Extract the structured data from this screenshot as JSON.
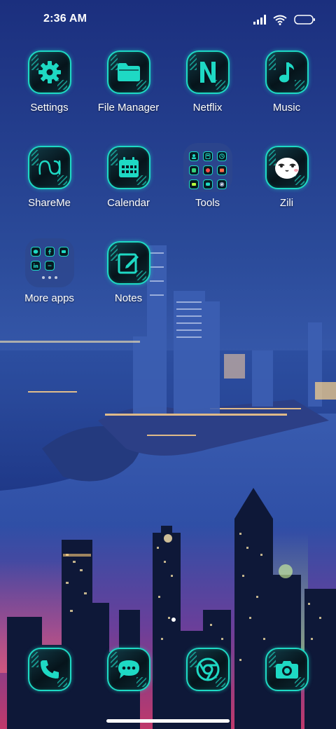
{
  "status_bar": {
    "time": "2:36 AM"
  },
  "apps": [
    {
      "label": "Settings",
      "icon": "gear-icon"
    },
    {
      "label": "File Manager",
      "icon": "folder-icon"
    },
    {
      "label": "Netflix",
      "icon": "netflix-n-icon"
    },
    {
      "label": "Music",
      "icon": "music-note-icon"
    },
    {
      "label": "ShareMe",
      "icon": "shareme-icon"
    },
    {
      "label": "Calendar",
      "icon": "calendar-icon"
    },
    {
      "label": "Tools",
      "icon": "tools-folder-icon"
    },
    {
      "label": "Zili",
      "icon": "zili-face-icon"
    },
    {
      "label": "More apps",
      "icon": "more-apps-folder-icon"
    },
    {
      "label": "Notes",
      "icon": "notes-icon"
    }
  ],
  "dock": [
    {
      "icon": "phone-icon"
    },
    {
      "icon": "messages-icon"
    },
    {
      "icon": "chrome-icon"
    },
    {
      "icon": "camera-icon"
    }
  ],
  "colors": {
    "accent": "#1ed9c4",
    "tile_bg": "#071a22",
    "wallpaper_top": "#1a2f7d",
    "wallpaper_bottom": "#c13a6a"
  }
}
